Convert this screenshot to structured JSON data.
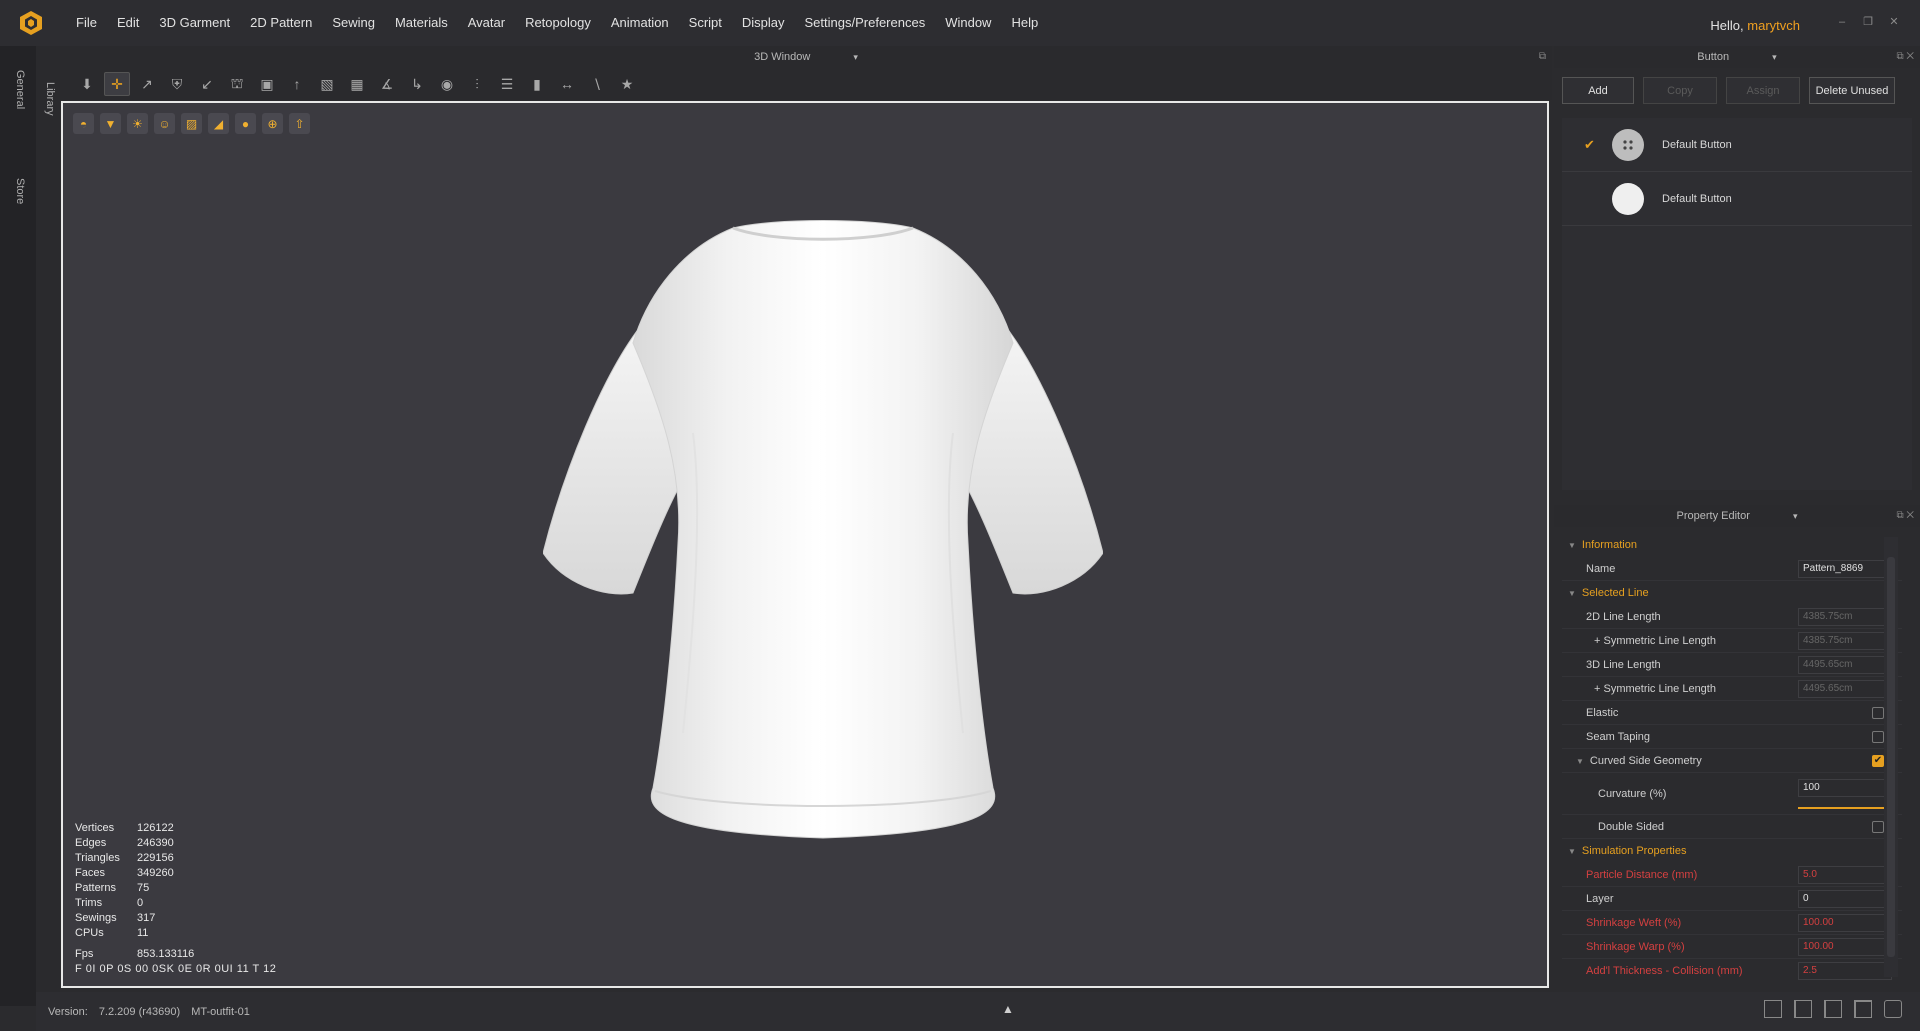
{
  "menu": [
    "File",
    "Edit",
    "3D Garment",
    "2D Pattern",
    "Sewing",
    "Materials",
    "Avatar",
    "Retopology",
    "Animation",
    "Script",
    "Display",
    "Settings/Preferences",
    "Window",
    "Help"
  ],
  "user": {
    "greeting": "Hello,",
    "name": "marytvch"
  },
  "left_tabs": {
    "general": "General",
    "store": "Store",
    "library": "Library"
  },
  "viewport": {
    "title": "3D Window",
    "stats": [
      {
        "label": "Vertices",
        "value": "126122"
      },
      {
        "label": "Edges",
        "value": "246390"
      },
      {
        "label": "Triangles",
        "value": "229156"
      },
      {
        "label": "Faces",
        "value": "349260"
      },
      {
        "label": "Patterns",
        "value": "75"
      },
      {
        "label": "Trims",
        "value": "0"
      },
      {
        "label": "Sewings",
        "value": "317"
      },
      {
        "label": "CPUs",
        "value": "11"
      }
    ],
    "fps_label": "Fps",
    "fps_value": "853.133116",
    "extra_line": "F 0I 0P 0S 00 0SK 0E 0R 0UI 11 T 12"
  },
  "button_panel": {
    "title": "Button",
    "actions": {
      "add": "Add",
      "copy": "Copy",
      "assign": "Assign",
      "delete_unused": "Delete Unused"
    },
    "items": [
      {
        "name": "Default Button",
        "selected": true
      },
      {
        "name": "Default Button",
        "selected": false
      }
    ]
  },
  "property_editor": {
    "title": "Property Editor",
    "information": {
      "section": "Information",
      "name_label": "Name",
      "name_value": "Pattern_8869"
    },
    "selected_line": {
      "section": "Selected Line",
      "line2d_label": "2D Line Length",
      "line2d_value": "4385.75cm",
      "sym2d_label": "+ Symmetric Line Length",
      "sym2d_value": "4385.75cm",
      "line3d_label": "3D Line Length",
      "line3d_value": "4495.65cm",
      "sym3d_label": "+ Symmetric Line Length",
      "sym3d_value": "4495.65cm",
      "elastic_label": "Elastic",
      "seam_label": "Seam Taping",
      "curved_label": "Curved Side Geometry",
      "curvature_label": "Curvature (%)",
      "curvature_value": "100",
      "double_label": "Double Sided"
    },
    "simulation": {
      "section": "Simulation Properties",
      "particle_label": "Particle Distance (mm)",
      "particle_value": "5.0",
      "layer_label": "Layer",
      "layer_value": "0",
      "weft_label": "Shrinkage Weft (%)",
      "weft_value": "100.00",
      "warp_label": "Shrinkage Warp (%)",
      "warp_value": "100.00",
      "thickness_label": "Add'l Thickness - Collision (mm)",
      "thickness_value": "2.5"
    }
  },
  "status": {
    "version_label": "Version:",
    "version_value": "7.2.209 (r43690)",
    "project": "MT-outfit-01"
  },
  "colors": {
    "accent": "#e6a020",
    "viewport_bg": "#3b3a40",
    "warning_text": "#d44040"
  }
}
